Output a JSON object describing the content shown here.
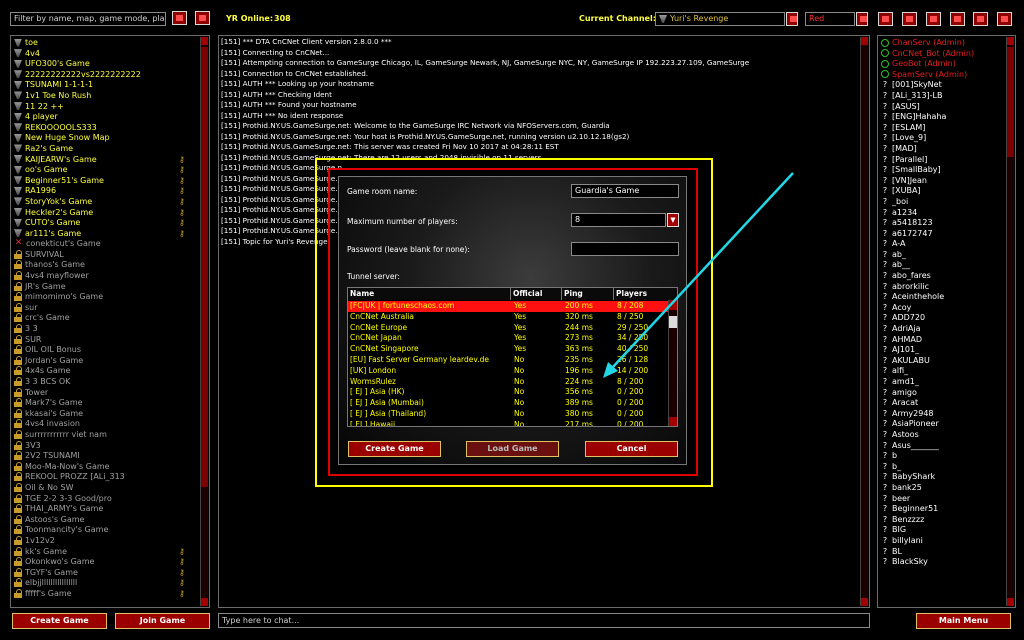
{
  "top_bar": {
    "filter_placeholder": "Filter by name, map, game mode, play",
    "online_label": "YR Online:",
    "online_count": "308",
    "channel_label": "Current Channel:",
    "channel_value": "Yuri's Revenge",
    "color_value": "Red"
  },
  "games": [
    {
      "name": "toe",
      "icon": "flag",
      "color": "#ffff40",
      "key": false
    },
    {
      "name": "4v4",
      "icon": "flag",
      "color": "#ffff40",
      "key": false
    },
    {
      "name": "UFO300's Game",
      "icon": "flag",
      "color": "#ffff40",
      "key": false
    },
    {
      "name": "22222222222vs2222222222",
      "icon": "flag",
      "color": "#ffff40",
      "key": false
    },
    {
      "name": "TSUNAMI 1-1-1-1",
      "icon": "flag",
      "color": "#ffff40",
      "key": false
    },
    {
      "name": "1v1 Toe No Rush",
      "icon": "flag",
      "color": "#ffff40",
      "key": false
    },
    {
      "name": "11 22 ++",
      "icon": "flag",
      "color": "#ffff40",
      "key": false
    },
    {
      "name": "4 player",
      "icon": "flag",
      "color": "#ffff40",
      "key": false
    },
    {
      "name": "REKOOOOOLS333",
      "icon": "flag",
      "color": "#ffff40",
      "key": false
    },
    {
      "name": "New Huge Snow Map",
      "icon": "flag",
      "color": "#ffff40",
      "key": false
    },
    {
      "name": "Ra2's Game",
      "icon": "flag",
      "color": "#ffff40",
      "key": false
    },
    {
      "name": "KAIJEARW's Game",
      "icon": "flag",
      "color": "#ffff40",
      "key": true
    },
    {
      "name": "oo's Game",
      "icon": "flag",
      "color": "#ffff40",
      "key": true
    },
    {
      "name": "Beginner51's Game",
      "icon": "flag",
      "color": "#ffff40",
      "key": true
    },
    {
      "name": "RA1996",
      "icon": "flag",
      "color": "#ffff40",
      "key": true
    },
    {
      "name": "StoryYok's Game",
      "icon": "flag",
      "color": "#ffff40",
      "key": true
    },
    {
      "name": "Heckler2's Game",
      "icon": "flag",
      "color": "#ffff40",
      "key": true
    },
    {
      "name": "CUTO's Game",
      "icon": "flag",
      "color": "#ffff40",
      "key": true
    },
    {
      "name": "ar111's Game",
      "icon": "flag",
      "color": "#ffff40",
      "key": true
    },
    {
      "name": "conekticut's Game",
      "icon": "x",
      "color": "#a0a0a0",
      "key": false
    },
    {
      "name": "SURVIVAL",
      "icon": "lock",
      "color": "#a0a0a0",
      "key": false
    },
    {
      "name": "thanos's Game",
      "icon": "lock",
      "color": "#a0a0a0",
      "key": false
    },
    {
      "name": "4vs4 mayflower",
      "icon": "lock",
      "color": "#a0a0a0",
      "key": false
    },
    {
      "name": "JR's Game",
      "icon": "lock",
      "color": "#a0a0a0",
      "key": false
    },
    {
      "name": "mimomimo's Game",
      "icon": "lock",
      "color": "#a0a0a0",
      "key": false
    },
    {
      "name": "sur",
      "icon": "lock",
      "color": "#a0a0a0",
      "key": false
    },
    {
      "name": "crc's Game",
      "icon": "lock",
      "color": "#a0a0a0",
      "key": false
    },
    {
      "name": "3 3",
      "icon": "lock",
      "color": "#a0a0a0",
      "key": false
    },
    {
      "name": "SUR",
      "icon": "lock",
      "color": "#a0a0a0",
      "key": false
    },
    {
      "name": "OIL OIL Bonus",
      "icon": "lock",
      "color": "#a0a0a0",
      "key": false
    },
    {
      "name": "Jordan's Game",
      "icon": "lock",
      "color": "#a0a0a0",
      "key": false
    },
    {
      "name": "4x4s Game",
      "icon": "lock",
      "color": "#a0a0a0",
      "key": false
    },
    {
      "name": "3 3 BCS OK",
      "icon": "lock",
      "color": "#a0a0a0",
      "key": false
    },
    {
      "name": "Tower",
      "icon": "lock",
      "color": "#a0a0a0",
      "key": false
    },
    {
      "name": "Mark7's Game",
      "icon": "lock",
      "color": "#a0a0a0",
      "key": false
    },
    {
      "name": "kkasai's Game",
      "icon": "lock",
      "color": "#a0a0a0",
      "key": false
    },
    {
      "name": "4vs4 invasion",
      "icon": "lock",
      "color": "#a0a0a0",
      "key": false
    },
    {
      "name": "surrrrrrrrrrr viet nam",
      "icon": "lock",
      "color": "#a0a0a0",
      "key": false
    },
    {
      "name": "3V3",
      "icon": "lock",
      "color": "#a0a0a0",
      "key": false
    },
    {
      "name": "2V2 TSUNAMI",
      "icon": "lock",
      "color": "#a0a0a0",
      "key": false
    },
    {
      "name": "Moo-Ma-Now's Game",
      "icon": "lock",
      "color": "#a0a0a0",
      "key": false
    },
    {
      "name": "REKOOL PROZZ   [ALi_313",
      "icon": "lock",
      "color": "#a0a0a0",
      "key": false
    },
    {
      "name": "Oil & No SW",
      "icon": "lock",
      "color": "#a0a0a0",
      "key": false
    },
    {
      "name": "TGE 2-2 3-3 Good/pro",
      "icon": "lock",
      "color": "#a0a0a0",
      "key": false
    },
    {
      "name": "THAI_ARMY's Game",
      "icon": "lock",
      "color": "#a0a0a0",
      "key": false
    },
    {
      "name": "Astoos's Game",
      "icon": "lock",
      "color": "#a0a0a0",
      "key": false
    },
    {
      "name": "Toonmancity's Game",
      "icon": "lock",
      "color": "#a0a0a0",
      "key": false
    },
    {
      "name": "1v12v2",
      "icon": "lock",
      "color": "#a0a0a0",
      "key": false
    },
    {
      "name": "kk's Game",
      "icon": "lock",
      "color": "#a0a0a0",
      "key": true
    },
    {
      "name": "Okonkwo's Game",
      "icon": "lock",
      "color": "#a0a0a0",
      "key": true
    },
    {
      "name": "TGYF's Game",
      "icon": "lock",
      "color": "#a0a0a0",
      "key": true
    },
    {
      "name": "elbjjllllllllllllllll",
      "icon": "lock",
      "color": "#a0a0a0",
      "key": true
    },
    {
      "name": "fffff's Game",
      "icon": "lock",
      "color": "#a0a0a0",
      "key": true
    }
  ],
  "chat_lines": [
    "[151] *** DTA CnCNet Client version 2.8.0.0 ***",
    "[151] Connecting to CnCNet...",
    "[151] Attempting connection to GameSurge Chicago, IL, GameSurge Newark, NJ, GameSurge NYC, NY, GameSurge IP 192.223.27.109, GameSurge",
    "[151] Connection to CnCNet established.",
    "[151] AUTH *** Looking up your hostname",
    "[151] AUTH *** Checking Ident",
    "[151] AUTH *** Found your hostname",
    "[151] AUTH *** No ident response",
    "[151] Prothid.NY.US.GameSurge.net: Welcome to the GameSurge IRC Network via NFOServers.com, Guardia",
    "[151] Prothid.NY.US.GameSurge.net: Your host is Prothid.NY.US.GameSurge.net, running version u2.10.12.18(gs2)",
    "[151] Prothid.NY.US.GameSurge.net: This server was created Fri Nov 10 2017 at 04:28:11 EST",
    "[151] Prothid.NY.US.GameSurge.net: There are 12 users and 2048 invisible on 11 servers",
    "[151] Prothid.NY.US.GameSurge.n",
    "[151] Prothid.NY.US.GameSurge.n",
    "[151] Prothid.NY.US.GameSurge.n",
    "[151] Prothid.NY.US.GameSurge.n",
    "[151] Prothid.NY.US.GameSurge.n",
    "[151] Prothid.NY.US.GameSurge.n",
    "[151] Prothid.NY.US.GameSurge.n",
    "[151] Topic for Yuri's Revenge"
  ],
  "chat_input_placeholder": "Type here to chat...",
  "buttons": {
    "create_game": "Create Game",
    "join_game": "Join Game",
    "main_menu": "Main Menu"
  },
  "users": [
    {
      "name": "ChanServ (Admin)",
      "type": "admin"
    },
    {
      "name": "CnCNet_Bot (Admin)",
      "type": "admin"
    },
    {
      "name": "GeoBot (Admin)",
      "type": "admin"
    },
    {
      "name": "SpamServ (Admin)",
      "type": "admin"
    },
    {
      "name": "[001]SkyNet",
      "type": "user"
    },
    {
      "name": "[ALi_313]-LB",
      "type": "user"
    },
    {
      "name": "[ASUS]",
      "type": "user"
    },
    {
      "name": "[ENG]Hahaha",
      "type": "user"
    },
    {
      "name": "[ESLAM]",
      "type": "user"
    },
    {
      "name": "[Love_9]",
      "type": "user"
    },
    {
      "name": "[MAD]",
      "type": "user"
    },
    {
      "name": "[Parallel]",
      "type": "user"
    },
    {
      "name": "[SmallBaby]",
      "type": "user"
    },
    {
      "name": "[VN]Jean",
      "type": "user"
    },
    {
      "name": "[XUBA]",
      "type": "user"
    },
    {
      "name": "_boi",
      "type": "user"
    },
    {
      "name": "a1234",
      "type": "user"
    },
    {
      "name": "a5418123",
      "type": "user"
    },
    {
      "name": "a6172747",
      "type": "user"
    },
    {
      "name": "A-A",
      "type": "user"
    },
    {
      "name": "ab_",
      "type": "user"
    },
    {
      "name": "ab__",
      "type": "user"
    },
    {
      "name": "abo_fares",
      "type": "user"
    },
    {
      "name": "abrorkilic",
      "type": "user"
    },
    {
      "name": "Aceinthehole",
      "type": "user"
    },
    {
      "name": "Acoy",
      "type": "user"
    },
    {
      "name": "ADD720",
      "type": "user"
    },
    {
      "name": "AdriAja",
      "type": "user"
    },
    {
      "name": "AHMAD",
      "type": "user"
    },
    {
      "name": "AJ101_",
      "type": "user"
    },
    {
      "name": "AKULABU",
      "type": "user"
    },
    {
      "name": "alfi_",
      "type": "user"
    },
    {
      "name": "amd1_",
      "type": "user"
    },
    {
      "name": "amigo",
      "type": "user"
    },
    {
      "name": "Aracat",
      "type": "user"
    },
    {
      "name": "Army2948",
      "type": "user"
    },
    {
      "name": "AsiaPioneer",
      "type": "user"
    },
    {
      "name": "Astoos",
      "type": "user"
    },
    {
      "name": "Asus_______",
      "type": "user"
    },
    {
      "name": "b",
      "type": "user"
    },
    {
      "name": "b_",
      "type": "user"
    },
    {
      "name": "BabyShark",
      "type": "user"
    },
    {
      "name": "bank25",
      "type": "user"
    },
    {
      "name": "beer",
      "type": "user"
    },
    {
      "name": "Beginner51",
      "type": "user"
    },
    {
      "name": "Benzzzz",
      "type": "user"
    },
    {
      "name": "BIG",
      "type": "user"
    },
    {
      "name": "billylani",
      "type": "user"
    },
    {
      "name": "BL",
      "type": "user"
    },
    {
      "name": "BlackSky",
      "type": "user"
    }
  ],
  "dialog": {
    "room_name_label": "Game room name:",
    "room_name_value": "Guardia's Game",
    "max_players_label": "Maximum number of players:",
    "max_players_value": "8",
    "password_label": "Password (leave blank for none):",
    "password_value": "",
    "tunnel_label": "Tunnel server:",
    "columns": [
      "Name",
      "Official",
      "Ping",
      "Players"
    ],
    "rows": [
      {
        "name": "[FC|UK | fortuneschaos.com",
        "official": "Yes",
        "ping": "200 ms",
        "players": "8 / 208",
        "selected": true
      },
      {
        "name": "CnCNet Australia",
        "official": "Yes",
        "ping": "320 ms",
        "players": "8 / 250",
        "selected": false
      },
      {
        "name": "CnCNet Europe",
        "official": "Yes",
        "ping": "244 ms",
        "players": "29 / 250",
        "selected": false
      },
      {
        "name": "CnCNet Japan",
        "official": "Yes",
        "ping": "273 ms",
        "players": "34 / 250",
        "selected": false
      },
      {
        "name": "CnCNet Singapore",
        "official": "Yes",
        "ping": "363 ms",
        "players": "40 / 250",
        "selected": false
      },
      {
        "name": "[EU] Fast Server Germany leardev.de",
        "official": "No",
        "ping": "235 ms",
        "players": "26 / 128",
        "selected": false
      },
      {
        "name": "[UK] London",
        "official": "No",
        "ping": "196 ms",
        "players": "14 / 200",
        "selected": false
      },
      {
        "name": "WormsRulez",
        "official": "No",
        "ping": "224 ms",
        "players": "8 / 200",
        "selected": false
      },
      {
        "name": "[ EJ ] Asia (HK)",
        "official": "No",
        "ping": "356 ms",
        "players": "0 / 200",
        "selected": false
      },
      {
        "name": "[ EJ ] Asia (Mumbai)",
        "official": "No",
        "ping": "389 ms",
        "players": "0 / 200",
        "selected": false
      },
      {
        "name": "[ EJ ] Asia (Thailand)",
        "official": "No",
        "ping": "380 ms",
        "players": "0 / 200",
        "selected": false
      },
      {
        "name": "[ EJ ] Hawaii",
        "official": "No",
        "ping": "217 ms",
        "players": "0 / 200",
        "selected": false
      }
    ],
    "create_button": "Create Game",
    "load_button": "Load Game",
    "cancel_button": "Cancel"
  },
  "colors": {
    "accent_red": "#9a0000",
    "highlight_yellow": "#ffff00",
    "annotation_arrow": "#22d8e6",
    "selected_row": "#ff1010"
  }
}
